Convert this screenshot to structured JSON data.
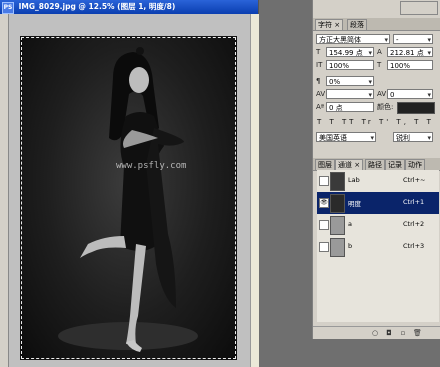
{
  "document": {
    "title": "IMG_8029.jpg @ 12.5% (图层 1, 明度/8)",
    "app_icon": "PS",
    "watermark": "www.psfly.com"
  },
  "character_panel": {
    "tabs": [
      "字符 ×",
      "段落"
    ],
    "font_family": "方正大黑简体",
    "font_style": "-",
    "font_size": "154.99 点",
    "leading": "212.81 点",
    "vertical_scale": "100%",
    "horizontal_scale": "100%",
    "tracking_percent": "0%",
    "kerning_label": "AV",
    "tracking_label": "AV",
    "tracking_value": "0",
    "baseline": "0 点",
    "color_label": "颜色:",
    "color_hex": "#222222",
    "style_buttons": "T T TT Tr T' T, T T",
    "language": "美国英语",
    "antialias": "锐利"
  },
  "channels_panel": {
    "tabs": [
      "图层",
      "通道 ×",
      "路径",
      "记录",
      "动作"
    ],
    "channels": [
      {
        "name": "Lab",
        "shortcut": "Ctrl+~",
        "selected": false,
        "visible": false
      },
      {
        "name": "明度",
        "shortcut": "Ctrl+1",
        "selected": true,
        "visible": true
      },
      {
        "name": "a",
        "shortcut": "Ctrl+2",
        "selected": false,
        "visible": false
      },
      {
        "name": "b",
        "shortcut": "Ctrl+3",
        "selected": false,
        "visible": false
      }
    ]
  },
  "icons": {
    "close": "close-icon",
    "eye": "eye-icon"
  }
}
